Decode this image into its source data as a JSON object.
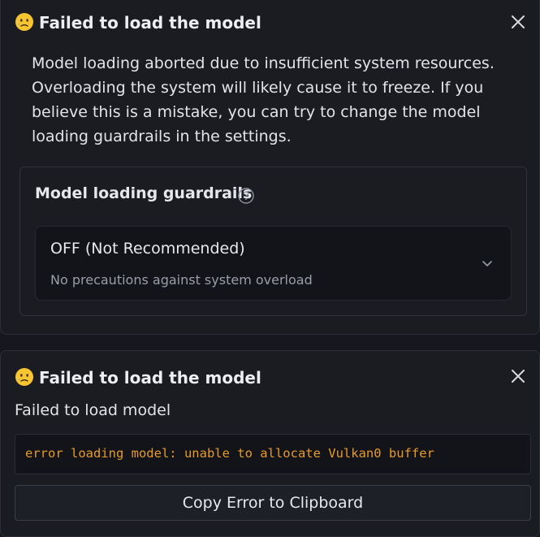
{
  "colors": {
    "background": "#16181d",
    "toast_bg": "#1a1c22",
    "select_bg": "#121419",
    "error_text": "#e79a2a",
    "muted_text": "#9a9ea8"
  },
  "toast_resources": {
    "emoji_icon": "sad-tear-face-icon",
    "title": "Failed to load the model",
    "close_icon": "close-icon",
    "message": "Model loading aborted due to insufficient system resources. Overloading the system will likely cause it to freeze. If you believe this is a mistake, you can try to change the model loading guardrails in the settings.",
    "guardrails": {
      "label": "Model loading guardrails",
      "help_icon": "help-circle-icon",
      "selected_value": "OFF (Not Recommended)",
      "selected_description": "No precautions against system overload",
      "dropdown_icon": "chevron-down-icon"
    }
  },
  "toast_error": {
    "emoji_icon": "sad-tear-face-icon",
    "title": "Failed to load the model",
    "close_icon": "close-icon",
    "heading": "Failed to load model",
    "error_message": "error loading model: unable to allocate Vulkan0 buffer",
    "copy_button_label": "Copy Error to Clipboard"
  }
}
